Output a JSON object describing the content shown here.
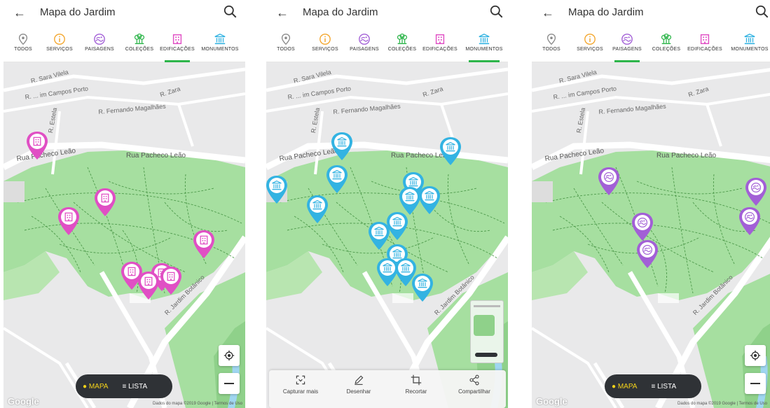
{
  "screens": [
    {
      "title": "Mapa do Jardim",
      "active_category": "EDIFICAÇÕES",
      "pin_type": "building",
      "pin_color": "#e04fc4"
    },
    {
      "title": "Mapa do Jardim",
      "active_category": "MONUMENTOS",
      "pin_type": "monument",
      "pin_color": "#33b3e2"
    },
    {
      "title": "Mapa do Jardim",
      "active_category": "PAISAGENS",
      "pin_type": "landscape",
      "pin_color": "#a25fd6"
    }
  ],
  "categories": [
    {
      "label": "TODOS",
      "icon": "location-pin-icon",
      "color": "#8a8a8a"
    },
    {
      "label": "SERVIÇOS",
      "icon": "info-icon",
      "color": "#f3a52b"
    },
    {
      "label": "PAISAGENS",
      "icon": "landscape-icon",
      "color": "#a25fd6"
    },
    {
      "label": "COLEÇÕES",
      "icon": "plants-icon",
      "color": "#2db54a"
    },
    {
      "label": "EDIFICAÇÕES",
      "icon": "building-icon",
      "color": "#e04fc4"
    },
    {
      "label": "MONUMENTOS",
      "icon": "monument-icon",
      "color": "#33b3e2"
    }
  ],
  "streets": {
    "sara_vilela": "R. Sara Vilela",
    "campos_porto": "R. ... im Campos Porto",
    "zara": "R. Zara",
    "fernando_magalhaes": "R. Fernando Magalhães",
    "estela": "R. Estela",
    "pacheco_leao": "Rua Pacheco Leão",
    "jardim_botanico": "R. Jardim Botânico",
    "saint_roman": "R.",
    "sarita": "Sa"
  },
  "bottom_nav": {
    "mapa": "MAPA",
    "lista": "LISTA"
  },
  "map_credits": "Dados do mapa ©2019 Google",
  "terms": "Termos de Uso",
  "google": "Google",
  "capture_toolbar": {
    "capturar": "Capturar mais",
    "desenhar": "Desenhar",
    "recortar": "Recortar",
    "compartilhar": "Compartilhar"
  }
}
